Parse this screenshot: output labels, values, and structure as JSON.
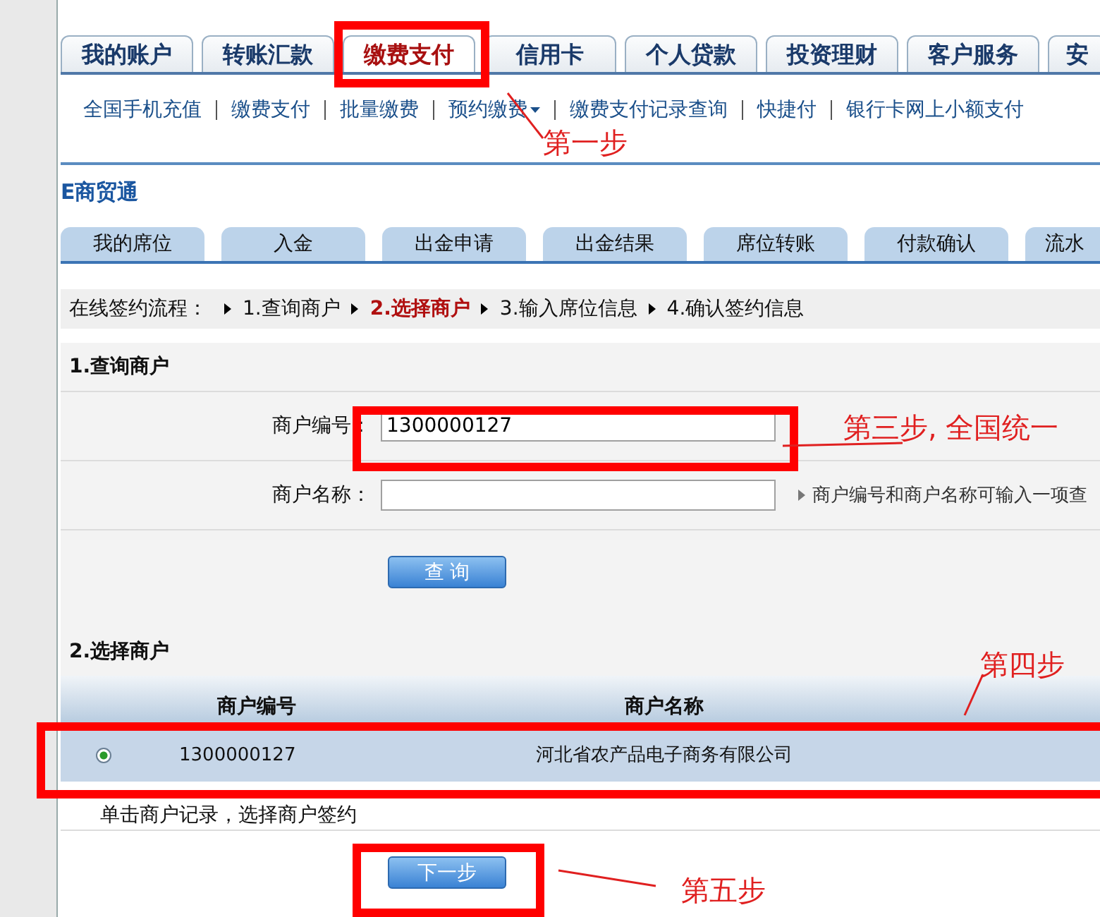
{
  "main_tabs": [
    {
      "label": "我的账户",
      "selected": false
    },
    {
      "label": "转账汇款",
      "selected": false
    },
    {
      "label": "缴费支付",
      "selected": true
    },
    {
      "label": "信用卡",
      "selected": false
    },
    {
      "label": "个人贷款",
      "selected": false
    },
    {
      "label": "投资理财",
      "selected": false
    },
    {
      "label": "客户服务",
      "selected": false
    },
    {
      "label": "安",
      "selected": false
    }
  ],
  "sub_nav": [
    {
      "label": "全国手机充值",
      "dropdown": false
    },
    {
      "label": "缴费支付",
      "dropdown": false
    },
    {
      "label": "批量缴费",
      "dropdown": false
    },
    {
      "label": "预约缴费",
      "dropdown": true
    },
    {
      "label": "缴费支付记录查询",
      "dropdown": false
    },
    {
      "label": "快捷付",
      "dropdown": false
    },
    {
      "label": "银行卡网上小额支付",
      "dropdown": false
    }
  ],
  "section_title": "E商贸通",
  "sub_tabs": [
    {
      "label": "我的席位"
    },
    {
      "label": "入金"
    },
    {
      "label": "出金申请"
    },
    {
      "label": "出金结果"
    },
    {
      "label": "席位转账"
    },
    {
      "label": "付款确认"
    },
    {
      "label": "流水"
    }
  ],
  "flow": {
    "label": "在线签约流程：",
    "steps": [
      {
        "label": "1.查询商户",
        "current": false
      },
      {
        "label": "2.选择商户",
        "current": true
      },
      {
        "label": "3.输入席位信息",
        "current": false
      },
      {
        "label": "4.确认签约信息",
        "current": false
      }
    ]
  },
  "query": {
    "title": "1.查询商户",
    "fields": [
      {
        "label": "商户编号：",
        "value": "1300000127"
      },
      {
        "label": "商户名称：",
        "hint": "商户编号和商户名称可输入一项查"
      }
    ],
    "button": "查 询"
  },
  "select": {
    "title": "2.选择商户",
    "columns": [
      "商户编号",
      "商户名称"
    ],
    "rows": [
      {
        "selected": true,
        "merchant_id": "1300000127",
        "merchant_name": "河北省农产品电子商务有限公司"
      }
    ],
    "note": "单击商户记录，选择商户签约"
  },
  "next_button": "下一步",
  "annotations": [
    {
      "label": "第一步"
    },
    {
      "label": "第三步, 全国统一"
    },
    {
      "label": "第四步"
    },
    {
      "label": "第五步"
    }
  ]
}
